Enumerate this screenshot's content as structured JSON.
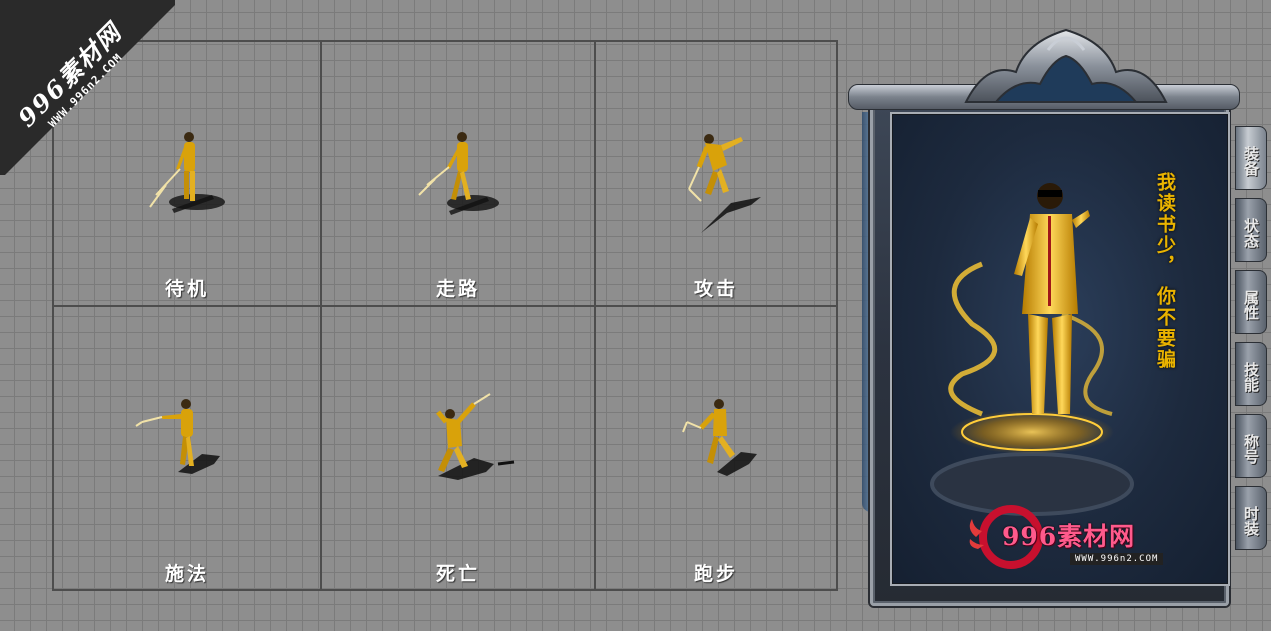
{
  "watermark": {
    "main": "996素材网",
    "sub": "WWW.996n2.COM"
  },
  "animations": {
    "cells": [
      {
        "label": "待机"
      },
      {
        "label": "走路"
      },
      {
        "label": "攻击"
      },
      {
        "label": "施法"
      },
      {
        "label": "死亡"
      },
      {
        "label": "跑步"
      }
    ]
  },
  "character_panel": {
    "tabs": [
      {
        "label": "装备"
      },
      {
        "label": "状态"
      },
      {
        "label": "属性"
      },
      {
        "label": "技能"
      },
      {
        "label": "称号"
      },
      {
        "label": "时装"
      }
    ],
    "poem_columns": [
      "我读书少，",
      "你不要骗"
    ],
    "logo_text": "996素材网",
    "logo_sub": "WWW.996n2.COM"
  },
  "colors": {
    "background": "#8e8e8e",
    "grid_line": "#7b7b7b",
    "border": "#4d4d4d",
    "gold": "#e9b300",
    "logo_pink": "#ff5a8c"
  },
  "icons": {
    "character_sprite": "gold-jumpsuit-fighter-icon",
    "nunchaku": "nunchaku-icon",
    "crown": "ornate-crown-frame-icon",
    "logo_flame": "flame-ring-icon"
  }
}
